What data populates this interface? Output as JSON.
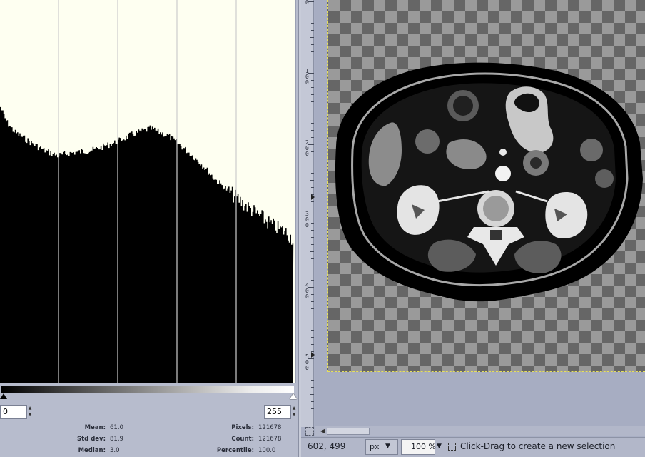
{
  "histogram": {
    "range_min": "0",
    "range_max": "255",
    "stats_left": [
      {
        "label": "Mean:",
        "value": "61.0"
      },
      {
        "label": "Std dev:",
        "value": "81.9"
      },
      {
        "label": "Median:",
        "value": "3.0"
      }
    ],
    "stats_right": [
      {
        "label": "Pixels:",
        "value": "121678"
      },
      {
        "label": "Count:",
        "value": "121678"
      },
      {
        "label": "Percentile:",
        "value": "100.0"
      }
    ]
  },
  "ruler": {
    "labels": [
      "0",
      "100",
      "200",
      "300",
      "400",
      "500"
    ]
  },
  "status": {
    "coords": "602, 499",
    "unit": "px",
    "zoom": "100 %",
    "message": "Click-Drag to create a new selection"
  },
  "icons": {
    "unit_dropdown": "chevron-down-icon",
    "zoom_dropdown": "chevron-down-icon",
    "selection": "rect-select-icon",
    "navigate": "navigate-icon",
    "scroll_left": "arrow-left-icon"
  },
  "colors": {
    "histogram_bg": "#fefff1",
    "histogram_bars": "#000000",
    "canvas_bg": "#a7adc2",
    "panel_bg": "#b7bccd",
    "canvas_border": "#e8e15a"
  }
}
